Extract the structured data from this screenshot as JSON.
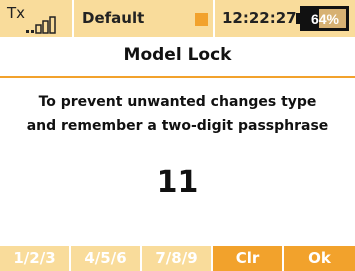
{
  "status_bar": {
    "tx_label": "Tx",
    "model_name": "Default",
    "time": "12:22:27",
    "battery_percent": "64%",
    "battery_level": 0.64
  },
  "page": {
    "title": "Model Lock",
    "message_line1": "To prevent unwanted changes type",
    "message_line2": "and remember a two-digit passphrase",
    "passcode": "11"
  },
  "softkeys": [
    {
      "label": "1/2/3",
      "enabled": false
    },
    {
      "label": "4/5/6",
      "enabled": false
    },
    {
      "label": "7/8/9",
      "enabled": false
    },
    {
      "label": "Clr",
      "enabled": true
    },
    {
      "label": "Ok",
      "enabled": true
    }
  ],
  "colors": {
    "accent": "#f2a22c",
    "status_bg": "#f9dc9b",
    "battery_fill": "#d7b173"
  },
  "icons": [
    "signal-bars-icon",
    "alarm-indicator-icon",
    "battery-icon"
  ]
}
